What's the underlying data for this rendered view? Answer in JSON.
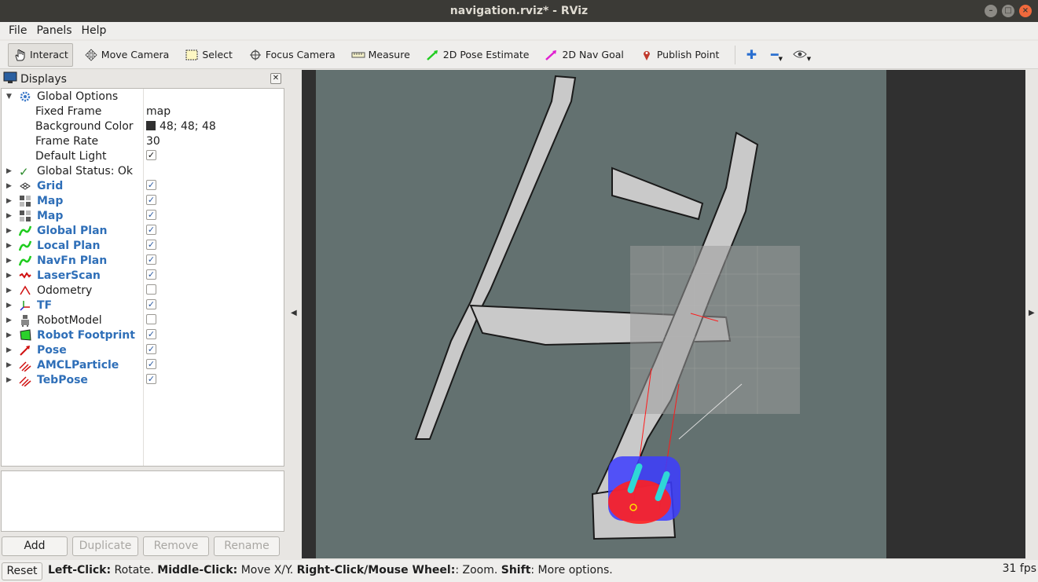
{
  "window": {
    "title": "navigation.rviz* - RViz"
  },
  "menu": {
    "items": [
      "File",
      "Panels",
      "Help"
    ]
  },
  "toolbar": {
    "tools": [
      {
        "label": "Interact",
        "icon": "hand-icon",
        "active": true
      },
      {
        "label": "Move Camera",
        "icon": "move-camera-icon",
        "active": false
      },
      {
        "label": "Select",
        "icon": "select-icon",
        "active": false
      },
      {
        "label": "Focus Camera",
        "icon": "focus-camera-icon",
        "active": false
      },
      {
        "label": "Measure",
        "icon": "ruler-icon",
        "active": false
      },
      {
        "label": "2D Pose Estimate",
        "icon": "green-arrow-icon",
        "active": false
      },
      {
        "label": "2D Nav Goal",
        "icon": "magenta-arrow-icon",
        "active": false
      },
      {
        "label": "Publish Point",
        "icon": "map-pin-icon",
        "active": false
      }
    ]
  },
  "displays": {
    "title": "Displays",
    "global_options": {
      "label": "Global Options",
      "fixed_frame_label": "Fixed Frame",
      "fixed_frame_value": "map",
      "background_label": "Background Color",
      "background_value": "48; 48; 48",
      "frame_rate_label": "Frame Rate",
      "frame_rate_value": "30",
      "default_light_label": "Default Light"
    },
    "global_status": "Global Status: Ok",
    "items": [
      {
        "label": "Grid",
        "icon": "grid-icon",
        "checked": true,
        "bold": true
      },
      {
        "label": "Map",
        "icon": "map-icon",
        "checked": true,
        "bold": true
      },
      {
        "label": "Map",
        "icon": "map-icon",
        "checked": true,
        "bold": true
      },
      {
        "label": "Global Plan",
        "icon": "path-icon",
        "checked": true,
        "bold": true
      },
      {
        "label": "Local Plan",
        "icon": "path-icon",
        "checked": true,
        "bold": true
      },
      {
        "label": "NavFn Plan",
        "icon": "path-icon",
        "checked": true,
        "bold": true
      },
      {
        "label": "LaserScan",
        "icon": "laserscan-icon",
        "checked": true,
        "bold": true
      },
      {
        "label": "Odometry",
        "icon": "odometry-icon",
        "checked": false,
        "bold": false
      },
      {
        "label": "TF",
        "icon": "tf-icon",
        "checked": true,
        "bold": true
      },
      {
        "label": "RobotModel",
        "icon": "robot-model-icon",
        "checked": false,
        "bold": false
      },
      {
        "label": "Robot Footprint",
        "icon": "footprint-icon",
        "checked": true,
        "bold": true
      },
      {
        "label": "Pose",
        "icon": "pose-icon",
        "checked": true,
        "bold": true
      },
      {
        "label": "AMCLParticle",
        "icon": "pose-array-icon",
        "checked": true,
        "bold": true
      },
      {
        "label": "TebPose",
        "icon": "pose-array-icon",
        "checked": true,
        "bold": true
      }
    ],
    "buttons": {
      "add": "Add",
      "duplicate": "Duplicate",
      "remove": "Remove",
      "rename": "Rename"
    }
  },
  "status": {
    "reset": "Reset",
    "left_click_label": "Left-Click:",
    "left_click_text": " Rotate. ",
    "middle_click_label": "Middle-Click:",
    "middle_click_text": " Move X/Y. ",
    "right_click_label": "Right-Click/Mouse Wheel:",
    "right_click_text": ": Zoom. ",
    "shift_label": "Shift",
    "shift_text": ": More options.",
    "fps": "31 fps"
  },
  "colors": {
    "background": "#303030",
    "map_free": "#c8c8c8",
    "map_unknown": "#637170",
    "costmap": "#8c8c8c",
    "laser": "#ff0000",
    "footprint": "#3c3cff",
    "path": "#00ff00"
  }
}
